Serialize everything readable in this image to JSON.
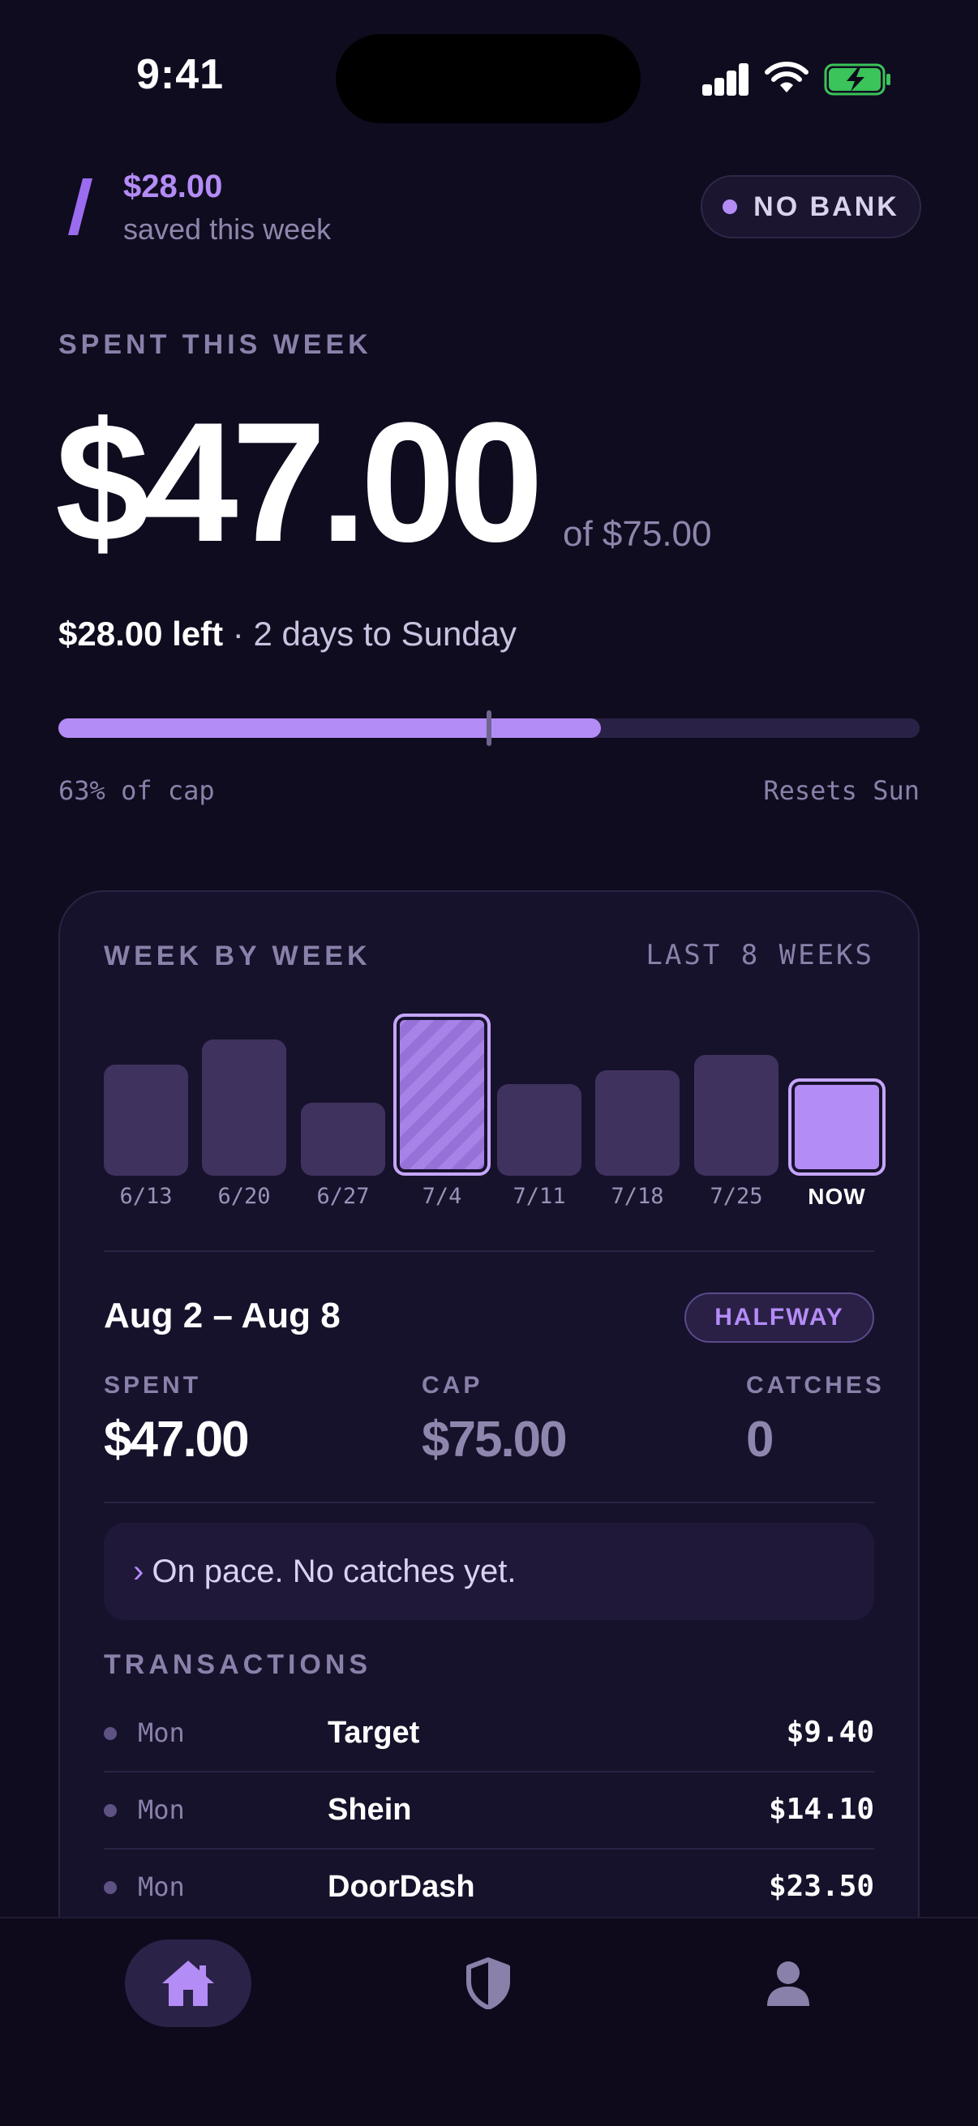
{
  "status_bar": {
    "time": "9:41"
  },
  "header": {
    "saved_amount": "$28.00",
    "saved_label": "saved this week",
    "bank_status": "NO BANK"
  },
  "summary": {
    "label": "SPENT THIS WEEK",
    "spent": "$47.00",
    "of_cap": "of $75.00",
    "left_amount": "$28.00 left",
    "left_detail": " · 2 days to Sunday",
    "progress_fraction": 0.63,
    "pct_label": "63% of cap",
    "reset_label": "Resets Sun"
  },
  "card": {
    "title": "WEEK BY WEEK",
    "range_label": "LAST 8 WEEKS",
    "week_range": "Aug 2 – Aug 8",
    "badge": "HALFWAY",
    "stats": [
      {
        "label": "SPENT",
        "value": "$47.00"
      },
      {
        "label": "CAP",
        "value": "$75.00"
      },
      {
        "label": "CATCHES",
        "value": "0"
      }
    ],
    "pace_chevron": "›",
    "pace_text": "On pace. No catches yet.",
    "transactions_label": "TRANSACTIONS",
    "transactions": [
      {
        "day": "Mon",
        "merchant": "Target",
        "amount": "$9.40"
      },
      {
        "day": "Mon",
        "merchant": "Shein",
        "amount": "$14.10"
      },
      {
        "day": "Mon",
        "merchant": "DoorDash",
        "amount": "$23.50"
      }
    ]
  },
  "chart_data": {
    "type": "bar",
    "categories": [
      "6/13",
      "6/20",
      "6/27",
      "7/4",
      "7/11",
      "7/18",
      "7/25",
      "NOW"
    ],
    "values": [
      65,
      80,
      43,
      95,
      54,
      62,
      71,
      57
    ],
    "highlighted": [
      "7/4",
      "NOW"
    ],
    "colors": {
      "bar": "#40325f",
      "highlight": "#b48cf6"
    }
  },
  "tabbar": {
    "tabs": [
      {
        "icon": "home-icon",
        "active": true
      },
      {
        "icon": "shield-icon",
        "active": false
      },
      {
        "icon": "profile-icon",
        "active": false
      }
    ]
  }
}
